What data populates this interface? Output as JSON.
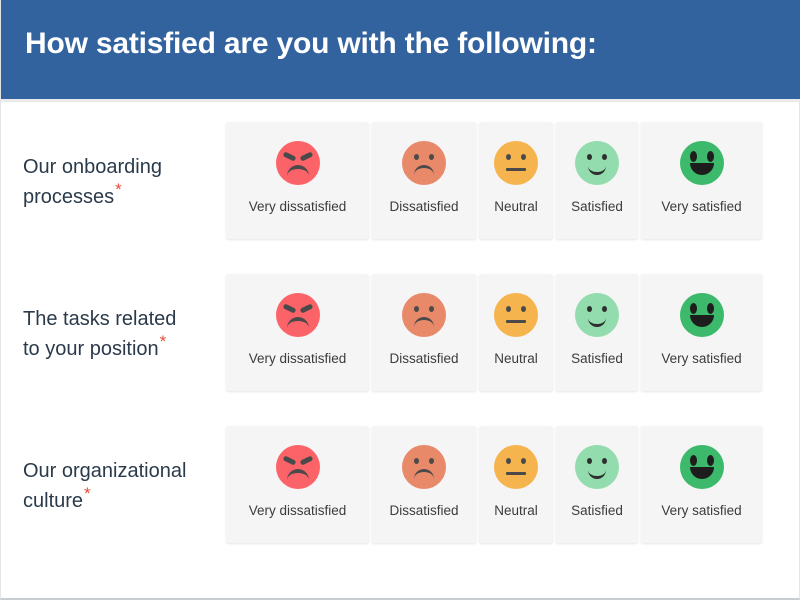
{
  "header": {
    "title": "How satisfied are you with the following:",
    "background_color": "#33639f",
    "text_color": "#ffffff"
  },
  "required_marker": "*",
  "required_marker_color": "#ea4a35",
  "scale": {
    "options": [
      {
        "label": "Very dissatisfied",
        "face": "angry-face-icon",
        "color": "#fb6368"
      },
      {
        "label": "Dissatisfied",
        "face": "sad-face-icon",
        "color": "#e8896a"
      },
      {
        "label": "Neutral",
        "face": "neutral-face-icon",
        "color": "#f6b44e"
      },
      {
        "label": "Satisfied",
        "face": "happy-face-icon",
        "color": "#93dcae"
      },
      {
        "label": "Very satisfied",
        "face": "grin-face-icon",
        "color": "#3cb96b"
      }
    ]
  },
  "questions": [
    {
      "line1": "Our onboarding",
      "line2": "processes",
      "required": true
    },
    {
      "line1": "The tasks related",
      "line2": "to your position",
      "required": true
    },
    {
      "line1": "Our organizational",
      "line2": "culture",
      "required": true
    }
  ]
}
